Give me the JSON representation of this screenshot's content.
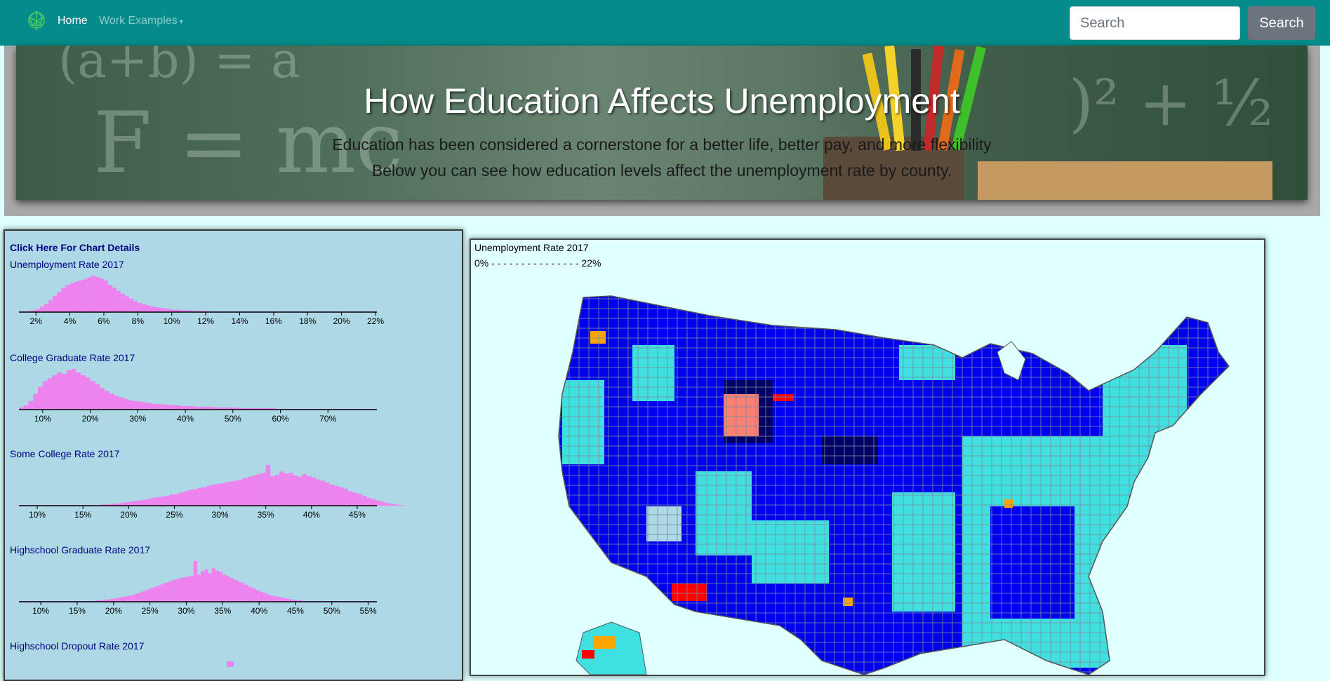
{
  "nav": {
    "home": "Home",
    "work_examples": "Work Examples",
    "search_placeholder": "Search",
    "search_button": "Search"
  },
  "hero": {
    "title": "How Education Affects Unemployment",
    "subtitle1": "Education has been considered a cornerstone for a better life, better pay, and more flexibility",
    "subtitle2": "Below you can see how education levels affect the unemployment rate by county."
  },
  "panel": {
    "details_link": "Click Here For Chart Details"
  },
  "colors": {
    "histogram_fill": "#ee82ee",
    "navbar": "#068b8b",
    "map_low": "#0000ee",
    "map_mid": "#40e0e0",
    "map_high": "#ff0000"
  },
  "chart_data": [
    {
      "type": "bar",
      "title": "Unemployment Rate 2017",
      "xlabel": "",
      "ylabel": "",
      "xlim": [
        1,
        22
      ],
      "ticks": [
        "2%",
        "4%",
        "6%",
        "8%",
        "10%",
        "12%",
        "14%",
        "16%",
        "18%",
        "20%",
        "22%"
      ],
      "tick_values": [
        2,
        4,
        6,
        8,
        10,
        12,
        14,
        16,
        18,
        20,
        22
      ],
      "bin_start": 1,
      "bin_width": 0.25,
      "values": [
        1,
        1,
        2,
        3,
        5,
        9,
        14,
        20,
        27,
        33,
        40,
        45,
        48,
        50,
        52,
        54,
        57,
        60,
        58,
        55,
        52,
        45,
        40,
        35,
        30,
        26,
        22,
        18,
        15,
        13,
        11,
        9,
        8,
        7,
        6,
        5,
        4,
        4,
        3,
        3,
        3,
        2,
        2,
        2,
        2,
        1,
        1,
        1,
        1,
        1,
        1,
        1,
        1,
        1,
        1,
        1,
        1,
        1,
        1,
        1,
        1,
        1,
        1,
        1,
        1,
        1,
        1,
        1,
        1,
        1,
        1,
        1,
        1,
        1,
        1,
        1,
        1,
        1,
        1,
        1,
        1,
        1,
        1,
        1
      ]
    },
    {
      "type": "bar",
      "title": "College Graduate Rate 2017",
      "xlabel": "",
      "ylabel": "",
      "xlim": [
        5,
        80
      ],
      "ticks": [
        "10%",
        "20%",
        "30%",
        "40%",
        "50%",
        "60%",
        "70%"
      ],
      "tick_values": [
        10,
        20,
        30,
        40,
        50,
        60,
        70
      ],
      "bin_start": 5,
      "bin_width": 1,
      "values": [
        3,
        6,
        12,
        22,
        32,
        40,
        44,
        48,
        52,
        50,
        55,
        57,
        52,
        48,
        45,
        40,
        36,
        30,
        26,
        22,
        19,
        17,
        15,
        13,
        12,
        11,
        10,
        9,
        8,
        8,
        7,
        7,
        6,
        6,
        5,
        5,
        5,
        4,
        4,
        4,
        4,
        3,
        3,
        3,
        3,
        3,
        2,
        2,
        2,
        2,
        2,
        2,
        2,
        2,
        1,
        1,
        1,
        1,
        1,
        1,
        1,
        1,
        1,
        1,
        1,
        1,
        1,
        1,
        1,
        1,
        1,
        1,
        1,
        1,
        1
      ]
    },
    {
      "type": "bar",
      "title": "Some College Rate 2017",
      "xlabel": "",
      "ylabel": "",
      "xlim": [
        8,
        47
      ],
      "ticks": [
        "10%",
        "15%",
        "20%",
        "25%",
        "30%",
        "35%",
        "40%",
        "45%"
      ],
      "tick_values": [
        10,
        15,
        20,
        25,
        30,
        35,
        40,
        45
      ],
      "bin_start": 8,
      "bin_width": 0.5,
      "values": [
        1,
        1,
        1,
        1,
        1,
        1,
        1,
        1,
        1,
        1,
        1,
        1,
        1,
        1,
        1,
        1,
        1,
        1,
        2,
        2,
        3,
        3,
        4,
        5,
        6,
        7,
        8,
        9,
        10,
        12,
        13,
        14,
        15,
        17,
        18,
        20,
        22,
        24,
        25,
        27,
        28,
        30,
        32,
        33,
        34,
        36,
        37,
        38,
        40,
        42,
        44,
        46,
        48,
        50,
        62,
        45,
        47,
        52,
        49,
        50,
        46,
        44,
        48,
        45,
        43,
        40,
        38,
        35,
        32,
        30,
        28,
        26,
        22,
        20,
        18,
        15,
        12,
        10,
        8,
        6,
        4,
        3,
        2,
        1
      ]
    },
    {
      "type": "bar",
      "title": "Highschool Graduate Rate 2017",
      "xlabel": "",
      "ylabel": "",
      "xlim": [
        7,
        56
      ],
      "ticks": [
        "10%",
        "15%",
        "20%",
        "25%",
        "30%",
        "35%",
        "40%",
        "45%",
        "50%",
        "55%"
      ],
      "tick_values": [
        10,
        15,
        20,
        25,
        30,
        35,
        40,
        45,
        50,
        55
      ],
      "bin_start": 7,
      "bin_width": 0.5,
      "values": [
        1,
        1,
        1,
        1,
        1,
        1,
        1,
        1,
        1,
        1,
        1,
        1,
        1,
        1,
        1,
        1,
        1,
        1,
        1,
        1,
        1,
        2,
        2,
        3,
        3,
        4,
        5,
        6,
        7,
        8,
        9,
        10,
        12,
        14,
        16,
        18,
        20,
        22,
        24,
        26,
        28,
        30,
        32,
        33,
        35,
        36,
        37,
        38,
        60,
        40,
        45,
        48,
        42,
        50,
        46,
        44,
        40,
        38,
        35,
        32,
        30,
        28,
        25,
        22,
        20,
        17,
        15,
        13,
        11,
        9,
        8,
        7,
        6,
        5,
        4,
        3,
        2,
        2,
        1,
        1,
        1,
        1,
        1,
        1,
        1,
        1,
        1,
        1,
        1,
        1,
        1,
        1,
        1,
        1,
        1,
        1,
        1,
        1
      ]
    },
    {
      "type": "bar",
      "title": "Highschool Dropout Rate 2017",
      "xlabel": "",
      "ylabel": "",
      "ticks": [],
      "values": []
    }
  ],
  "map": {
    "title": "Unemployment Rate 2017",
    "scale_low": "0%",
    "scale_dashes": "- - - - - - - - - - - - - - -",
    "scale_high": "22%"
  }
}
